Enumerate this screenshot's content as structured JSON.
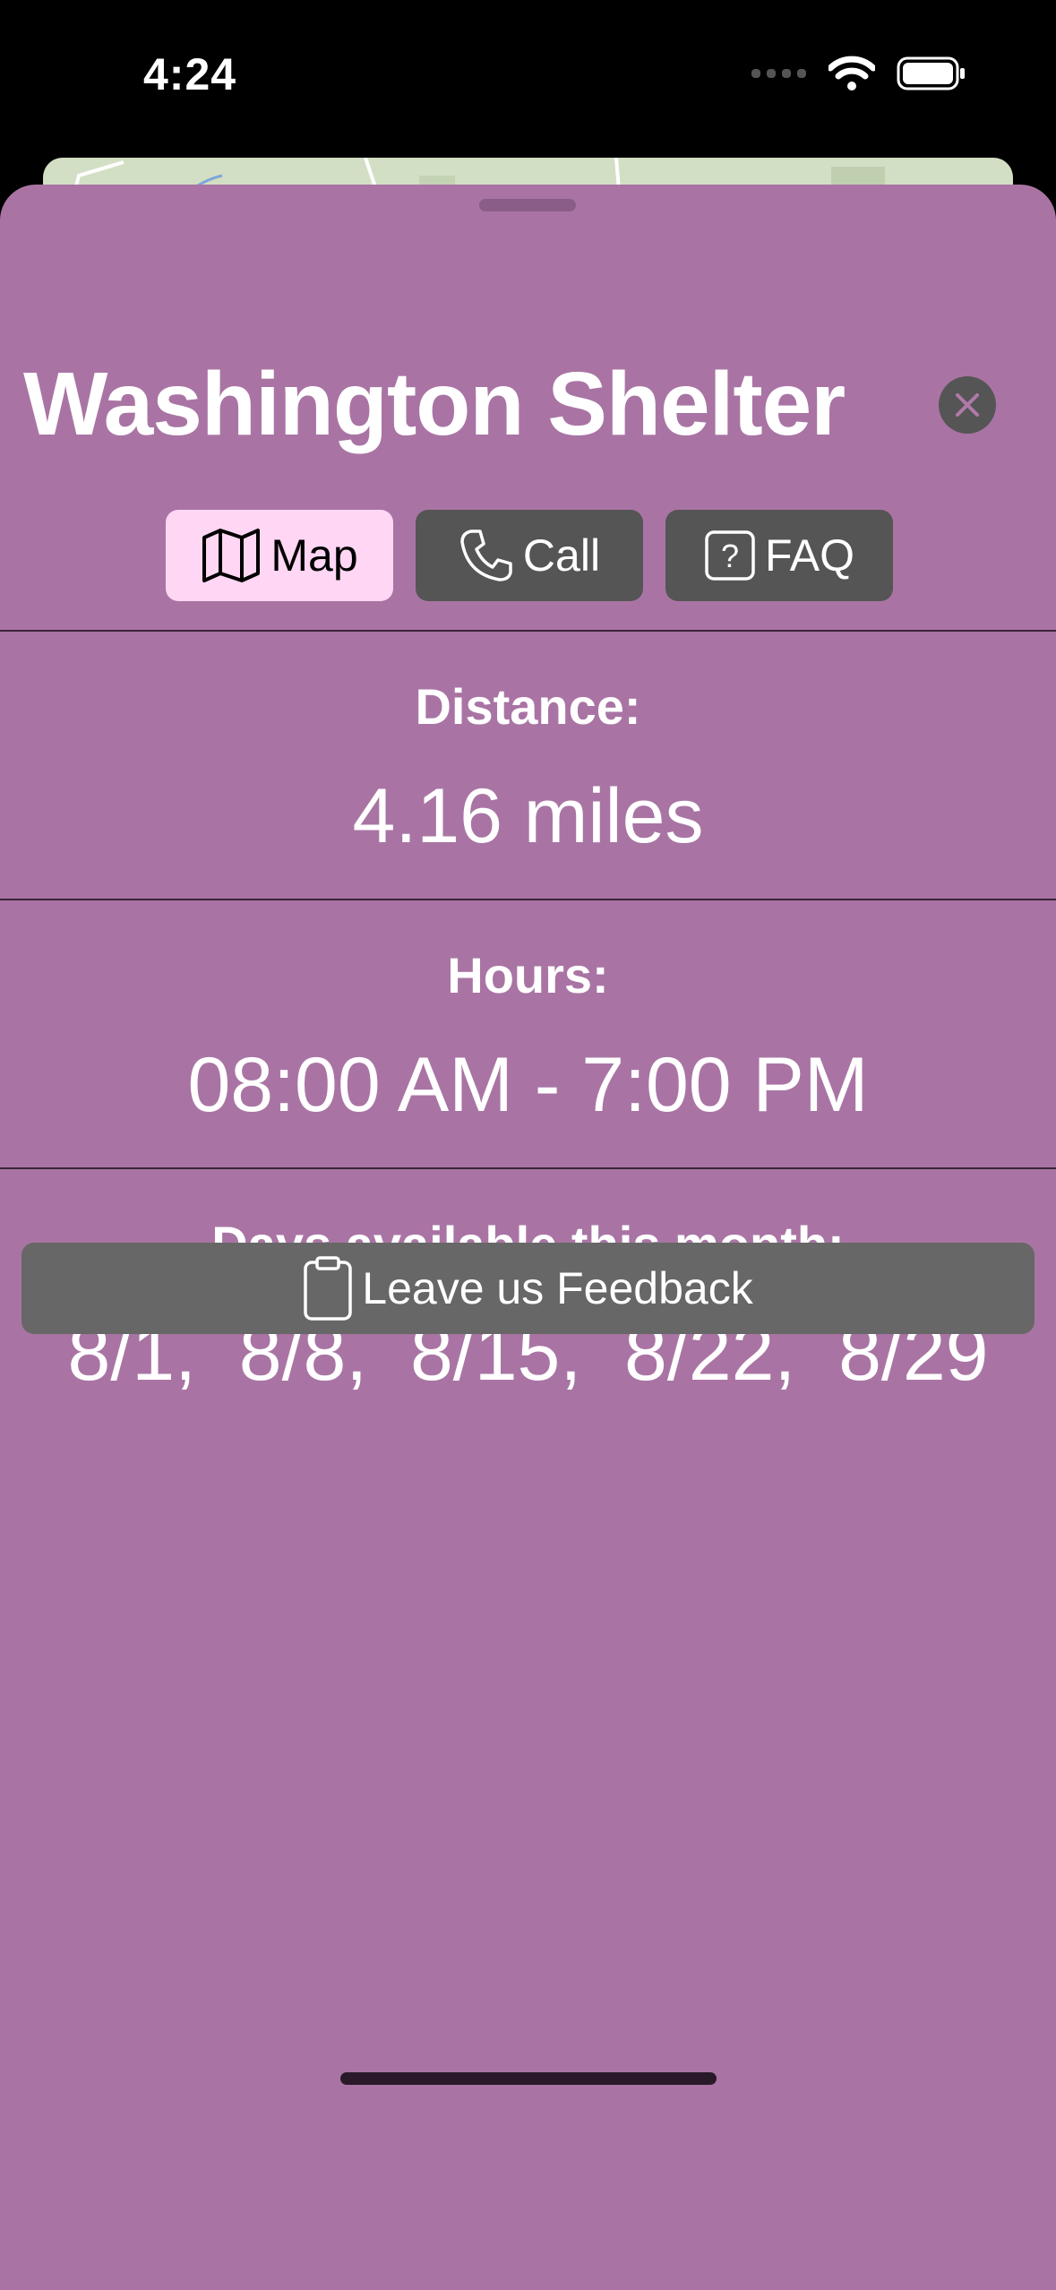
{
  "status_bar": {
    "time": "4:24"
  },
  "sheet": {
    "title": "Washington Shelter",
    "actions": [
      {
        "label": "Map",
        "icon": "map-icon",
        "selected": true
      },
      {
        "label": "Call",
        "icon": "phone-icon",
        "selected": false
      },
      {
        "label": "FAQ",
        "icon": "question-icon",
        "selected": false
      }
    ],
    "distance": {
      "label": "Distance:",
      "value": "4.16 miles"
    },
    "hours": {
      "label": "Hours:",
      "value": "08:00 AM - 7:00 PM"
    },
    "days": {
      "label": "Days available this month:",
      "value": "8/1,  8/8,  8/15,  8/22,  8/29"
    },
    "feedback": {
      "label": "Leave us Feedback",
      "icon": "clipboard-icon"
    }
  },
  "colors": {
    "sheet_background": "#a974a4",
    "button_dark": "#555555",
    "button_selected": "#ffd6f3",
    "feedback_button": "#676767"
  }
}
